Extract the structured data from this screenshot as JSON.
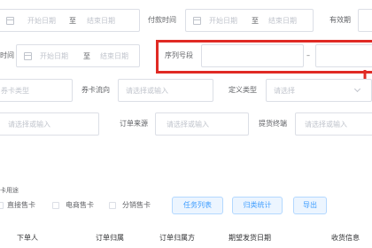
{
  "filters": {
    "start_date_placeholder": "开始日期",
    "to_label": "至",
    "end_date_placeholder": "结束日期",
    "payment_time_label": "付款时间",
    "validity_label": "有效期",
    "row2_left_label": "时间",
    "serial_segment_label": "序列号段",
    "range_dash": "–",
    "coupon_type_label": "券卡类型",
    "coupon_flow_label": "券卡流向",
    "select_or_input_placeholder": "请选择或输入",
    "definition_type_label": "定义类型",
    "select_placeholder": "请选择",
    "order_source_label": "订单来源",
    "pickup_terminal_label": "提货终端"
  },
  "sale_usage": {
    "section_label": "卡用途",
    "options": [
      {
        "label": "直接售卡",
        "checked": false
      },
      {
        "label": "电商售卡",
        "checked": false
      },
      {
        "label": "分销售卡",
        "checked": false
      }
    ]
  },
  "actions": {
    "task_list_label": "任务列表",
    "archive_stats_label": "归类统计",
    "export_label": "导出"
  },
  "table": {
    "columns": [
      "下单人",
      "订单归属",
      "订单归属方",
      "期望发货日期",
      "收货信息"
    ]
  },
  "colors": {
    "annotation_red": "#e02a24",
    "button_blue": "#409eff",
    "border": "#dcdfe6",
    "placeholder": "#c0c4cc"
  }
}
